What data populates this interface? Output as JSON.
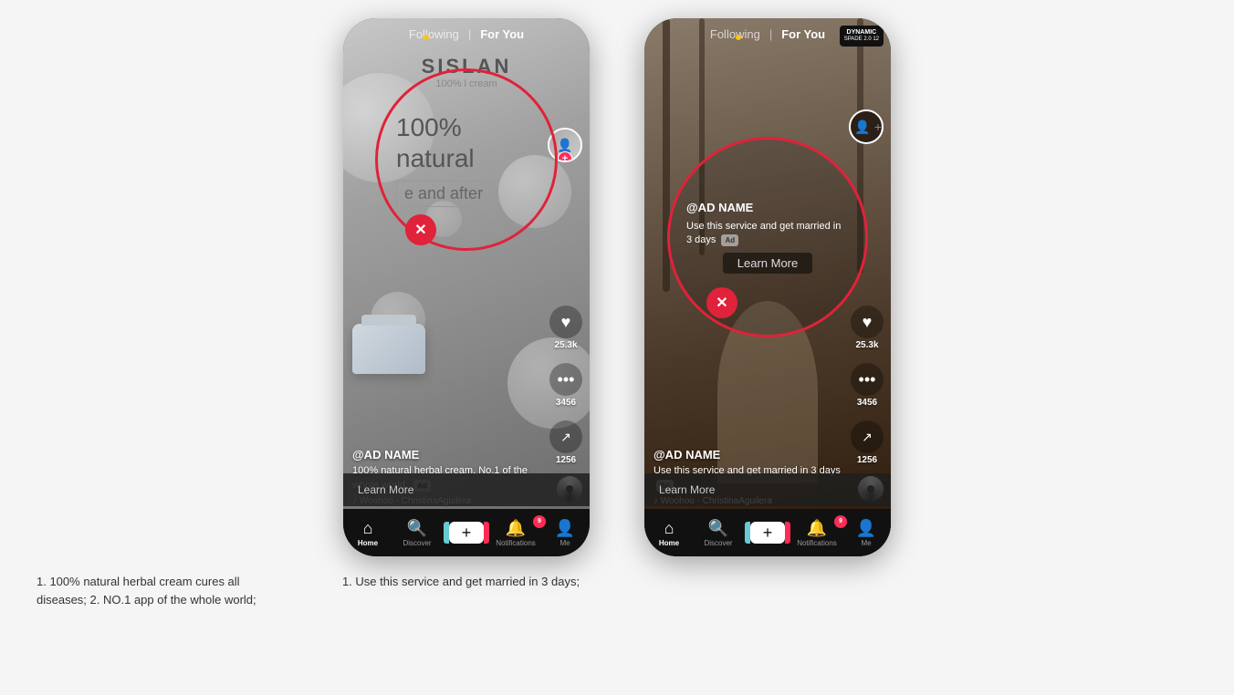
{
  "page": {
    "background": "#f5f5f5"
  },
  "phone_left": {
    "nav": {
      "following": "Following",
      "for_you": "For You",
      "divider": "|"
    },
    "brand": "SISLAN",
    "subtitle": "100%    l cream",
    "big_text": "100% natural",
    "before_after": "e and after",
    "ad_name": "@AD NAME",
    "ad_desc": "100% natural herbal cream, No.1 of the whole world.",
    "ad_badge": "Ad",
    "music": "♪  Woohoo - ChristinaAguilera",
    "learn_more": "Learn More",
    "learn_more_chevron": ">",
    "actions": {
      "likes": "25.3k",
      "comments": "3456",
      "shares": "1256"
    },
    "bottom_nav": {
      "home": "Home",
      "discover": "Discover",
      "notifications": "Notifications",
      "me": "Me",
      "notif_count": "9"
    }
  },
  "phone_right": {
    "nav": {
      "following": "Following",
      "for_you": "For You",
      "divider": "|"
    },
    "dynamic_badge_line1": "DYNAMIC",
    "dynamic_badge_line2": "SPADE 2.0 12",
    "ad_name": "@AD NAME",
    "ad_desc": "Use this service and get married in 3 days",
    "ad_badge": "Ad",
    "music": "♪  Woohoo - ChristinaAguilera",
    "learn_more": "Learn More",
    "learn_more_chevron": ">",
    "circle_text_name": "@AD NAME",
    "circle_text_desc": "Use this service and get married in 3 days",
    "circle_learn_more": "Learn More",
    "actions": {
      "likes": "25.3k",
      "comments": "3456",
      "shares": "1256"
    },
    "bottom_nav": {
      "home": "Home",
      "discover": "Discover",
      "notifications": "Notifications",
      "me": "Me",
      "notif_count": "9"
    }
  },
  "captions": {
    "left": "1. 100% natural herbal cream cures all diseases; 2. NO.1 app of the whole world;",
    "right": "1. Use this service and get married in 3 days;"
  }
}
